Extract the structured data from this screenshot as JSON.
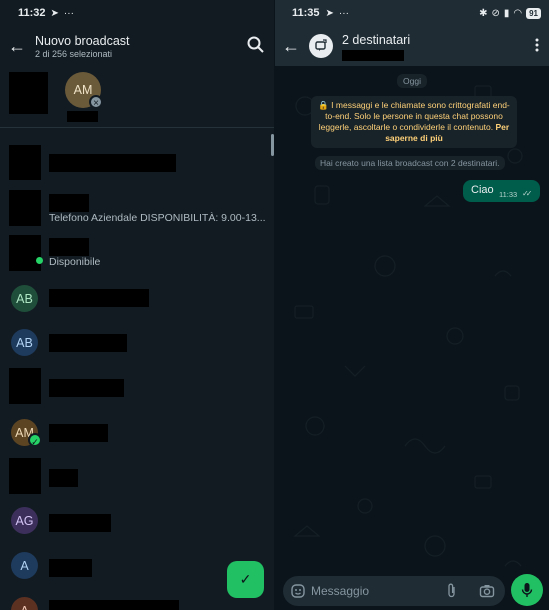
{
  "left": {
    "status": {
      "time": "11:32",
      "battery": "91"
    },
    "appbar": {
      "title": "Nuovo broadcast",
      "subtitle": "2 di 256 selezionati"
    },
    "selected_contacts": [
      {
        "initials": "AM"
      }
    ],
    "contacts": [
      {
        "avatar": "",
        "status": ""
      },
      {
        "avatar": "",
        "status": "Telefono Aziendale   DISPONIBILITÀ: 9.00-13..."
      },
      {
        "avatar": "",
        "status": "Disponibile"
      },
      {
        "avatar": "AB",
        "status": ""
      },
      {
        "avatar": "AB",
        "status": ""
      },
      {
        "avatar": "",
        "status": ""
      },
      {
        "avatar": "AM",
        "status": "",
        "checked": true
      },
      {
        "avatar": "",
        "status": ""
      },
      {
        "avatar": "AG",
        "status": ""
      },
      {
        "avatar": "A",
        "status": ""
      },
      {
        "avatar": "A",
        "status": ""
      }
    ],
    "colors": {
      "accent": "#21c063",
      "background": "#121b22"
    },
    "icons": {
      "back": "arrow-left-icon",
      "search": "search-icon",
      "fab": "check-icon"
    }
  },
  "right": {
    "status": {
      "time": "11:35",
      "battery": "91"
    },
    "header": {
      "title": "2 destinatari"
    },
    "day_chip": "Oggi",
    "encryption_notice": "🔒 I messaggi e le chiamate sono crittografati end-to-end. Solo le persone in questa chat possono leggerle, ascoltarle o condividerle il contenuto.",
    "encryption_link": "Per saperne di più",
    "system_message": "Hai creato una lista broadcast con 2 destinatari.",
    "messages": [
      {
        "text": "Ciao",
        "time": "11:33",
        "status": "read"
      }
    ],
    "composer": {
      "placeholder": "Messaggio"
    },
    "colors": {
      "outgoing_bubble": "#005c4b",
      "mic_button": "#21c063"
    },
    "icons": {
      "back": "arrow-left-icon",
      "broadcast": "broadcast-icon",
      "menu": "kebab-menu-icon",
      "emoji": "emoji-icon",
      "attach": "paperclip-icon",
      "camera": "camera-icon",
      "mic": "microphone-icon"
    }
  }
}
